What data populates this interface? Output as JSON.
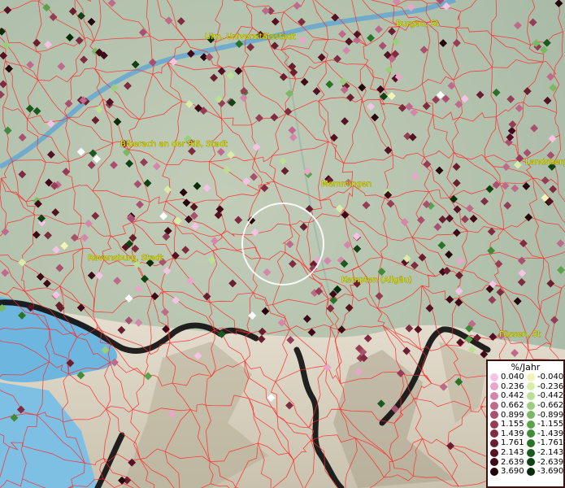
{
  "cities": [
    {
      "name": "Ulm, Universitätsstadt"
    },
    {
      "name": "Burgau, St"
    },
    {
      "name": "Biberach an der Riß, Stadt"
    },
    {
      "name": "Landsberg"
    },
    {
      "name": "Memmingen"
    },
    {
      "name": "Ravensburg, Stadt"
    },
    {
      "name": "Kempten (Allgäu)"
    },
    {
      "name": "Füssen, St"
    }
  ],
  "legend": {
    "title": "%/Jahr",
    "positive": [
      {
        "value": "0.040",
        "color": "#f5c3e3"
      },
      {
        "value": "0.236",
        "color": "#e8a6c9"
      },
      {
        "value": "0.442",
        "color": "#d487aa"
      },
      {
        "value": "0.662",
        "color": "#bf6a8a"
      },
      {
        "value": "0.899",
        "color": "#a8506d"
      },
      {
        "value": "1.155",
        "color": "#943d55"
      },
      {
        "value": "1.439",
        "color": "#7f2c40"
      },
      {
        "value": "1.761",
        "color": "#6a1e2e"
      },
      {
        "value": "2.143",
        "color": "#541222"
      },
      {
        "value": "2.639",
        "color": "#3e0a17"
      },
      {
        "value": "3.690",
        "color": "#26050c"
      }
    ],
    "negative": [
      {
        "value": "-0.040",
        "color": "#f2f5b8"
      },
      {
        "value": "-0.236",
        "color": "#d9ecaa"
      },
      {
        "value": "-0.442",
        "color": "#bcdf96"
      },
      {
        "value": "-0.662",
        "color": "#9ccd7c"
      },
      {
        "value": "-0.899",
        "color": "#7bb862"
      },
      {
        "value": "-1.155",
        "color": "#5ca24b"
      },
      {
        "value": "-1.439",
        "color": "#408a38"
      },
      {
        "value": "-1.761",
        "color": "#2b7229"
      },
      {
        "value": "-2.143",
        "color": "#1b5a1e"
      },
      {
        "value": "-2.639",
        "color": "#0f4314"
      },
      {
        "value": "-3.690",
        "color": "#062c0a"
      }
    ]
  },
  "colors": {
    "boundary": "#ff2a2a",
    "lake": "#6cb6e0",
    "river": "#5aa3d6",
    "terrain": "#b9c7b4",
    "mountain": "#d8d0be",
    "circle": "#ffffff"
  }
}
